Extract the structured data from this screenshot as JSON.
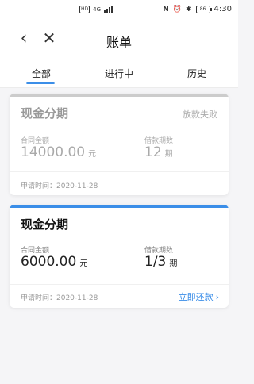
{
  "status_bar": {
    "sim_label": "HD",
    "network": "4G",
    "nfc": "N",
    "battery": "86",
    "time": "4:30"
  },
  "nav": {
    "back_icon": "‹",
    "close_icon": "✕",
    "title": "账单"
  },
  "tabs": [
    {
      "label": "全部",
      "active": true
    },
    {
      "label": "进行中",
      "active": false
    },
    {
      "label": "历史",
      "active": false
    }
  ],
  "cards": [
    {
      "title": "现金分期",
      "status": "放款失败",
      "amount_label": "合同金额",
      "amount_value": "14000.00",
      "amount_unit": "元",
      "term_label": "借款期数",
      "term_value": "12",
      "term_unit": "期",
      "apply_time": "申请时间：2020-11-28",
      "accent": "#cccccc"
    },
    {
      "title": "现金分期",
      "amount_label": "合同金额",
      "amount_value": "6000.00",
      "amount_unit": "元",
      "term_label": "借款期数",
      "term_value": "1/3",
      "term_unit": "期",
      "apply_time": "申请时间：2020-11-28",
      "action": "立即还款",
      "accent": "#3b8ee8"
    }
  ],
  "colors": {
    "accent": "#3b8ee8",
    "background": "#f5f5f7"
  }
}
